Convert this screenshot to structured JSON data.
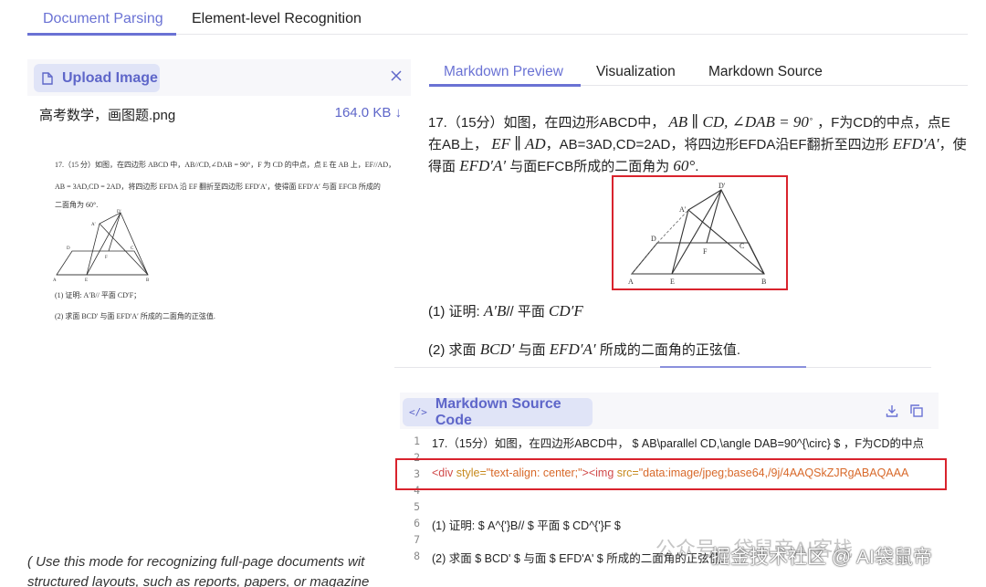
{
  "top_tabs": [
    {
      "label": "Document Parsing",
      "active": true
    },
    {
      "label": "Element-level Recognition",
      "active": false
    }
  ],
  "left": {
    "upload_label": "Upload Image",
    "file_name": "高考数学，画图题.png",
    "file_size": "164.0 KB",
    "preview_lines": [
      "17.（15 分）如图，在四边形 ABCD 中，AB//CD,∠DAB = 90°，F 为 CD 的中点，点 E 在 AB 上，EF//AD，",
      "AB = 3AD,CD = 2AD，将四边形 EFDA 沿 EF 翻折至四边形 EFD′A′，使得面 EFD′A′ 与面 EFCB 所成的",
      "二面角为 60°.",
      "(1) 证明: A′B// 平面 CD′F；",
      "(2) 求面 BCD′ 与面 EFD′A′ 所成的二面角的正弦值."
    ],
    "figure_labels": [
      "D'",
      "A'",
      "D",
      "F",
      "C",
      "A",
      "E",
      "B"
    ],
    "mode_hint_1": "( Use this mode for recognizing full-page documents wit",
    "mode_hint_2": "structured layouts, such as reports, papers, or magazine"
  },
  "right_tabs": [
    {
      "label": "Markdown Preview",
      "active": true
    },
    {
      "label": "Visualization",
      "active": false
    },
    {
      "label": "Markdown Source",
      "active": false
    }
  ],
  "preview": {
    "l1a": "17.（15分）如图，在四边形ABCD中，",
    "l1m1": "AB ∥ CD, ∠DAB = 90",
    "l1b": "，F为CD的中点，点E",
    "l2a": "在AB上，",
    "l2m1": "EF ∥ AD",
    "l2b": "，AB=3AD,CD=2AD，将四边形EFDA沿EF翻折至四边形",
    "l2m2": "EFD′A′",
    "l2c": "，使",
    "l3a": "得面",
    "l3m1": "EFD′A′",
    "l3b": "与面EFCB所成的二面角为",
    "l3m2": "60°",
    "l3c": ".",
    "p1a": "(1) 证明:",
    "p1m1": "A′B",
    "p1b": "// 平面",
    "p1m2": "CD′F",
    "p2a": "(2) 求面",
    "p2m1": "BCD′",
    "p2b": "与面",
    "p2m2": "EFD′A′",
    "p2c": "所成的二面角的正弦值."
  },
  "code": {
    "label": "Markdown Source Code",
    "icon_text": "</>",
    "line_numbers": [
      "1",
      "2",
      "3",
      "4",
      "5",
      "6",
      "7",
      "8"
    ],
    "line1": "17.（15分）如图，在四边形ABCD中， $ AB\\parallel CD,\\angle DAB=90^{\\circ} $ ，F为CD的中点",
    "line3_tag_open": "<div ",
    "line3_attr1": "style=",
    "line3_val1": "\"text-align: center;\"",
    "line3_mid": "><img ",
    "line3_attr2": "src=",
    "line3_val2": "\"data:image/jpeg;base64,/9j/4AAQSkZJRgABAQAAA",
    "line6": "(1) 证明: $ A^{'}B// $ 平面 $ CD^{'}F $",
    "line8": "(2) 求面 $ BCD' $ 与面 $ EFD'A' $ 所成的二面角的正弦值."
  },
  "watermark": {
    "line1": "公众号 · 袋鼠帝AI客栈",
    "line2": "掘金技术社区 @ AI袋鼠帝"
  },
  "colors": {
    "accent": "#6a72d4",
    "highlight_box": "#d9232d",
    "button_bg": "#e0e4f7"
  }
}
